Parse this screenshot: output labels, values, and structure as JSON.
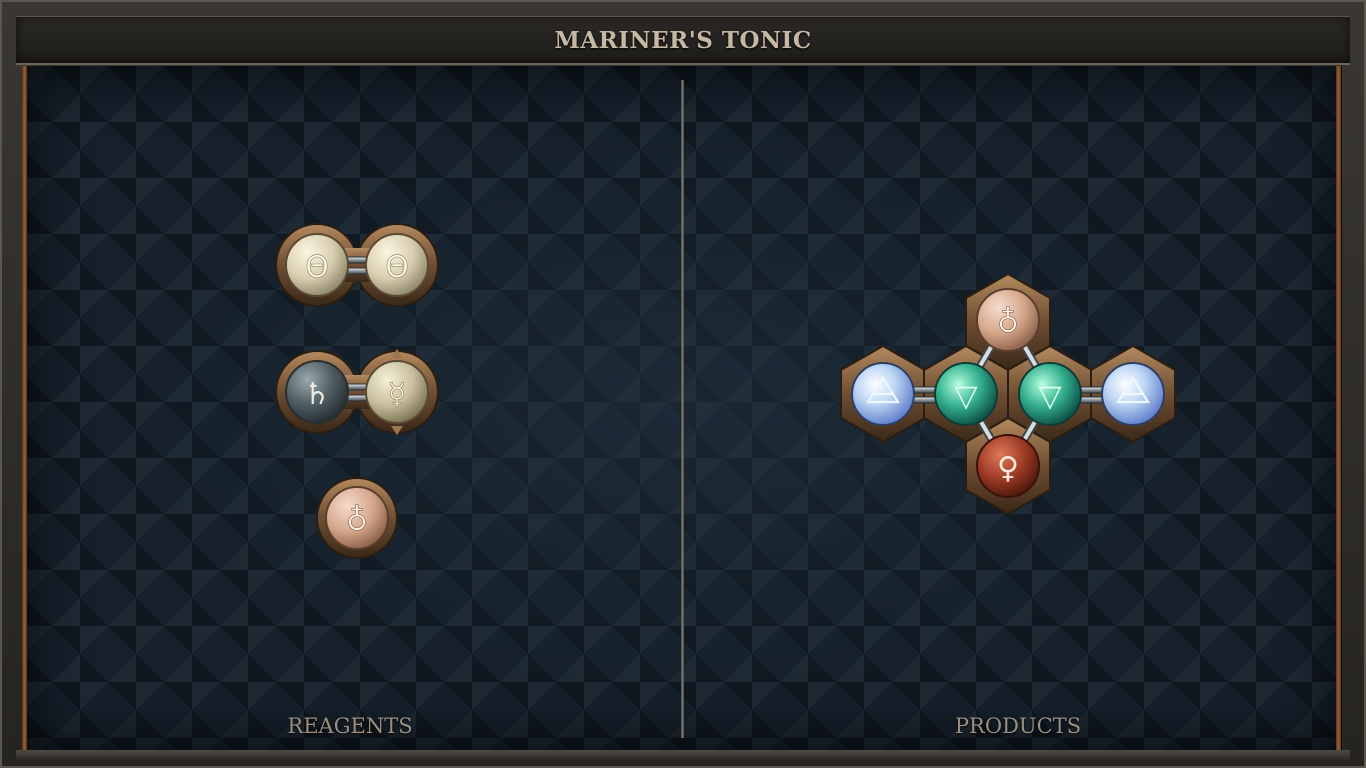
{
  "window": {
    "title": "MARINER'S TONIC"
  },
  "panels": {
    "reagents": {
      "label": "REAGENTS"
    },
    "products": {
      "label": "PRODUCTS"
    }
  },
  "reagents": [
    {
      "atoms": [
        {
          "element": "salt",
          "symbol": "Θ",
          "tone": "salt"
        },
        {
          "element": "salt",
          "symbol": "Θ",
          "tone": "salt"
        }
      ]
    },
    {
      "atoms": [
        {
          "element": "lead",
          "symbol": "♄",
          "tone": "lead"
        },
        {
          "element": "quicksilver",
          "symbol": "☿",
          "tone": "quicksilver"
        }
      ]
    },
    {
      "atoms": [
        {
          "element": "vitae",
          "symbol": "♁",
          "tone": "vitae"
        }
      ]
    }
  ],
  "product": {
    "atoms": [
      {
        "element": "vitae",
        "symbol": "♁",
        "tone": "vitae"
      },
      {
        "element": "air",
        "symbol": "ὰ1",
        "tone": "air"
      },
      {
        "element": "water",
        "symbol": "▽",
        "tone": "water"
      },
      {
        "element": "water",
        "symbol": "▽",
        "tone": "water"
      },
      {
        "element": "air",
        "symbol": "ὰ1",
        "tone": "air"
      },
      {
        "element": "copper",
        "symbol": "♀",
        "tone": "copper"
      }
    ]
  },
  "colors": {
    "salt": "#e3dcc2",
    "lead": "#5d6c72",
    "quicksilver": "#d7d0b5",
    "vitae": "#e2bba4",
    "air": "#b9d4f1",
    "water": "#4dbf9f",
    "copper": "#a4412b",
    "bronze": "#8a6947",
    "glyph_light": "#f3ead4",
    "glyph_dark": "#e8e6df",
    "glyph_air": "#e9f4ff",
    "glyph_water": "#d7fff2"
  }
}
